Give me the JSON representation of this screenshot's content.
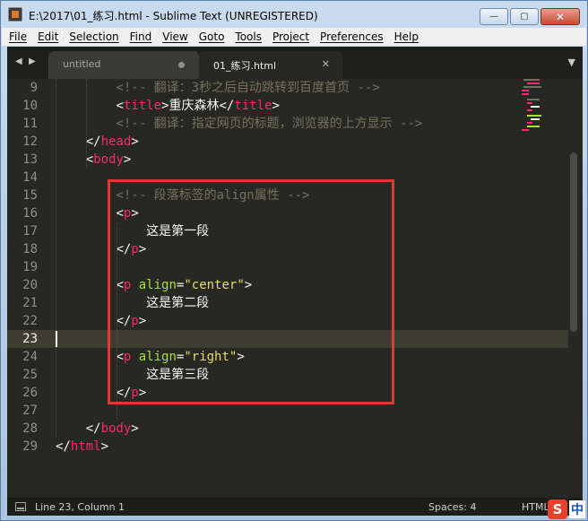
{
  "window": {
    "title": "E:\\2017\\01_练习.html - Sublime Text (UNREGISTERED)",
    "buttons": {
      "minimize": "—",
      "maximize": "▢",
      "close": "✕"
    }
  },
  "menu": [
    "File",
    "Edit",
    "Selection",
    "Find",
    "View",
    "Goto",
    "Tools",
    "Project",
    "Preferences",
    "Help"
  ],
  "tabs": [
    {
      "label": "untitled",
      "state": "modified"
    },
    {
      "label": "01_练习.html",
      "state": "active"
    }
  ],
  "editor": {
    "current_line": 23,
    "lines": [
      {
        "num": "9",
        "segments": [
          {
            "t": "<!-- 翻译：3秒之后自动跳转到百度首页 -->",
            "c": "cm"
          }
        ]
      },
      {
        "num": "10",
        "segments": [
          {
            "t": "<",
            "c": "txt"
          },
          {
            "t": "title",
            "c": "tag"
          },
          {
            "t": ">重庆森林</",
            "c": "txt"
          },
          {
            "t": "title",
            "c": "tag"
          },
          {
            "t": ">",
            "c": "txt"
          }
        ]
      },
      {
        "num": "11",
        "segments": [
          {
            "t": "<!-- 翻译：指定网页的标题，浏览器的上方显示 -->",
            "c": "cm"
          }
        ]
      },
      {
        "num": "12",
        "segments": [
          {
            "t": "</",
            "c": "txt"
          },
          {
            "t": "head",
            "c": "tag"
          },
          {
            "t": ">",
            "c": "txt"
          }
        ]
      },
      {
        "num": "13",
        "segments": [
          {
            "t": "<",
            "c": "txt"
          },
          {
            "t": "body",
            "c": "tag"
          },
          {
            "t": ">",
            "c": "txt"
          }
        ]
      },
      {
        "num": "14",
        "segments": []
      },
      {
        "num": "15",
        "segments": [
          {
            "t": "<!-- 段落标签的align属性 -->",
            "c": "cm"
          }
        ]
      },
      {
        "num": "16",
        "segments": [
          {
            "t": "<",
            "c": "txt"
          },
          {
            "t": "p",
            "c": "tag"
          },
          {
            "t": ">",
            "c": "txt"
          }
        ]
      },
      {
        "num": "17",
        "segments": [
          {
            "t": "这是第一段",
            "c": "txt"
          }
        ]
      },
      {
        "num": "18",
        "segments": [
          {
            "t": "</",
            "c": "txt"
          },
          {
            "t": "p",
            "c": "tag"
          },
          {
            "t": ">",
            "c": "txt"
          }
        ]
      },
      {
        "num": "19",
        "segments": []
      },
      {
        "num": "20",
        "segments": [
          {
            "t": "<",
            "c": "txt"
          },
          {
            "t": "p",
            "c": "tag"
          },
          {
            "t": " ",
            "c": "txt"
          },
          {
            "t": "align",
            "c": "attr"
          },
          {
            "t": "=",
            "c": "txt"
          },
          {
            "t": "\"center\"",
            "c": "str"
          },
          {
            "t": ">",
            "c": "txt"
          }
        ]
      },
      {
        "num": "21",
        "segments": [
          {
            "t": "这是第二段",
            "c": "txt"
          }
        ]
      },
      {
        "num": "22",
        "segments": [
          {
            "t": "</",
            "c": "txt"
          },
          {
            "t": "p",
            "c": "tag"
          },
          {
            "t": ">",
            "c": "txt"
          }
        ]
      },
      {
        "num": "23",
        "segments": []
      },
      {
        "num": "24",
        "segments": [
          {
            "t": "<",
            "c": "txt"
          },
          {
            "t": "p",
            "c": "tag"
          },
          {
            "t": " ",
            "c": "txt"
          },
          {
            "t": "align",
            "c": "attr"
          },
          {
            "t": "=",
            "c": "txt"
          },
          {
            "t": "\"right\"",
            "c": "str"
          },
          {
            "t": ">",
            "c": "txt"
          }
        ]
      },
      {
        "num": "25",
        "segments": [
          {
            "t": "这是第三段",
            "c": "txt"
          }
        ]
      },
      {
        "num": "26",
        "segments": [
          {
            "t": "</",
            "c": "txt"
          },
          {
            "t": "p",
            "c": "tag"
          },
          {
            "t": ">",
            "c": "txt"
          }
        ]
      },
      {
        "num": "27",
        "segments": []
      },
      {
        "num": "28",
        "segments": [
          {
            "t": "</",
            "c": "txt"
          },
          {
            "t": "body",
            "c": "tag"
          },
          {
            "t": ">",
            "c": "txt"
          }
        ]
      },
      {
        "num": "29",
        "segments": [
          {
            "t": "</",
            "c": "txt"
          },
          {
            "t": "html",
            "c": "tag"
          },
          {
            "t": ">",
            "c": "txt"
          }
        ]
      }
    ]
  },
  "status": {
    "position": "Line 23, Column 1",
    "indentation": "Spaces: 4",
    "syntax": "HTML"
  },
  "ime": {
    "logo": "S",
    "mode": "中"
  },
  "colors": {
    "background": "#272822",
    "comment": "#75715e",
    "tag": "#f92672",
    "attribute": "#a6e22e",
    "string": "#e6db74",
    "highlight_box": "#e0393b"
  }
}
